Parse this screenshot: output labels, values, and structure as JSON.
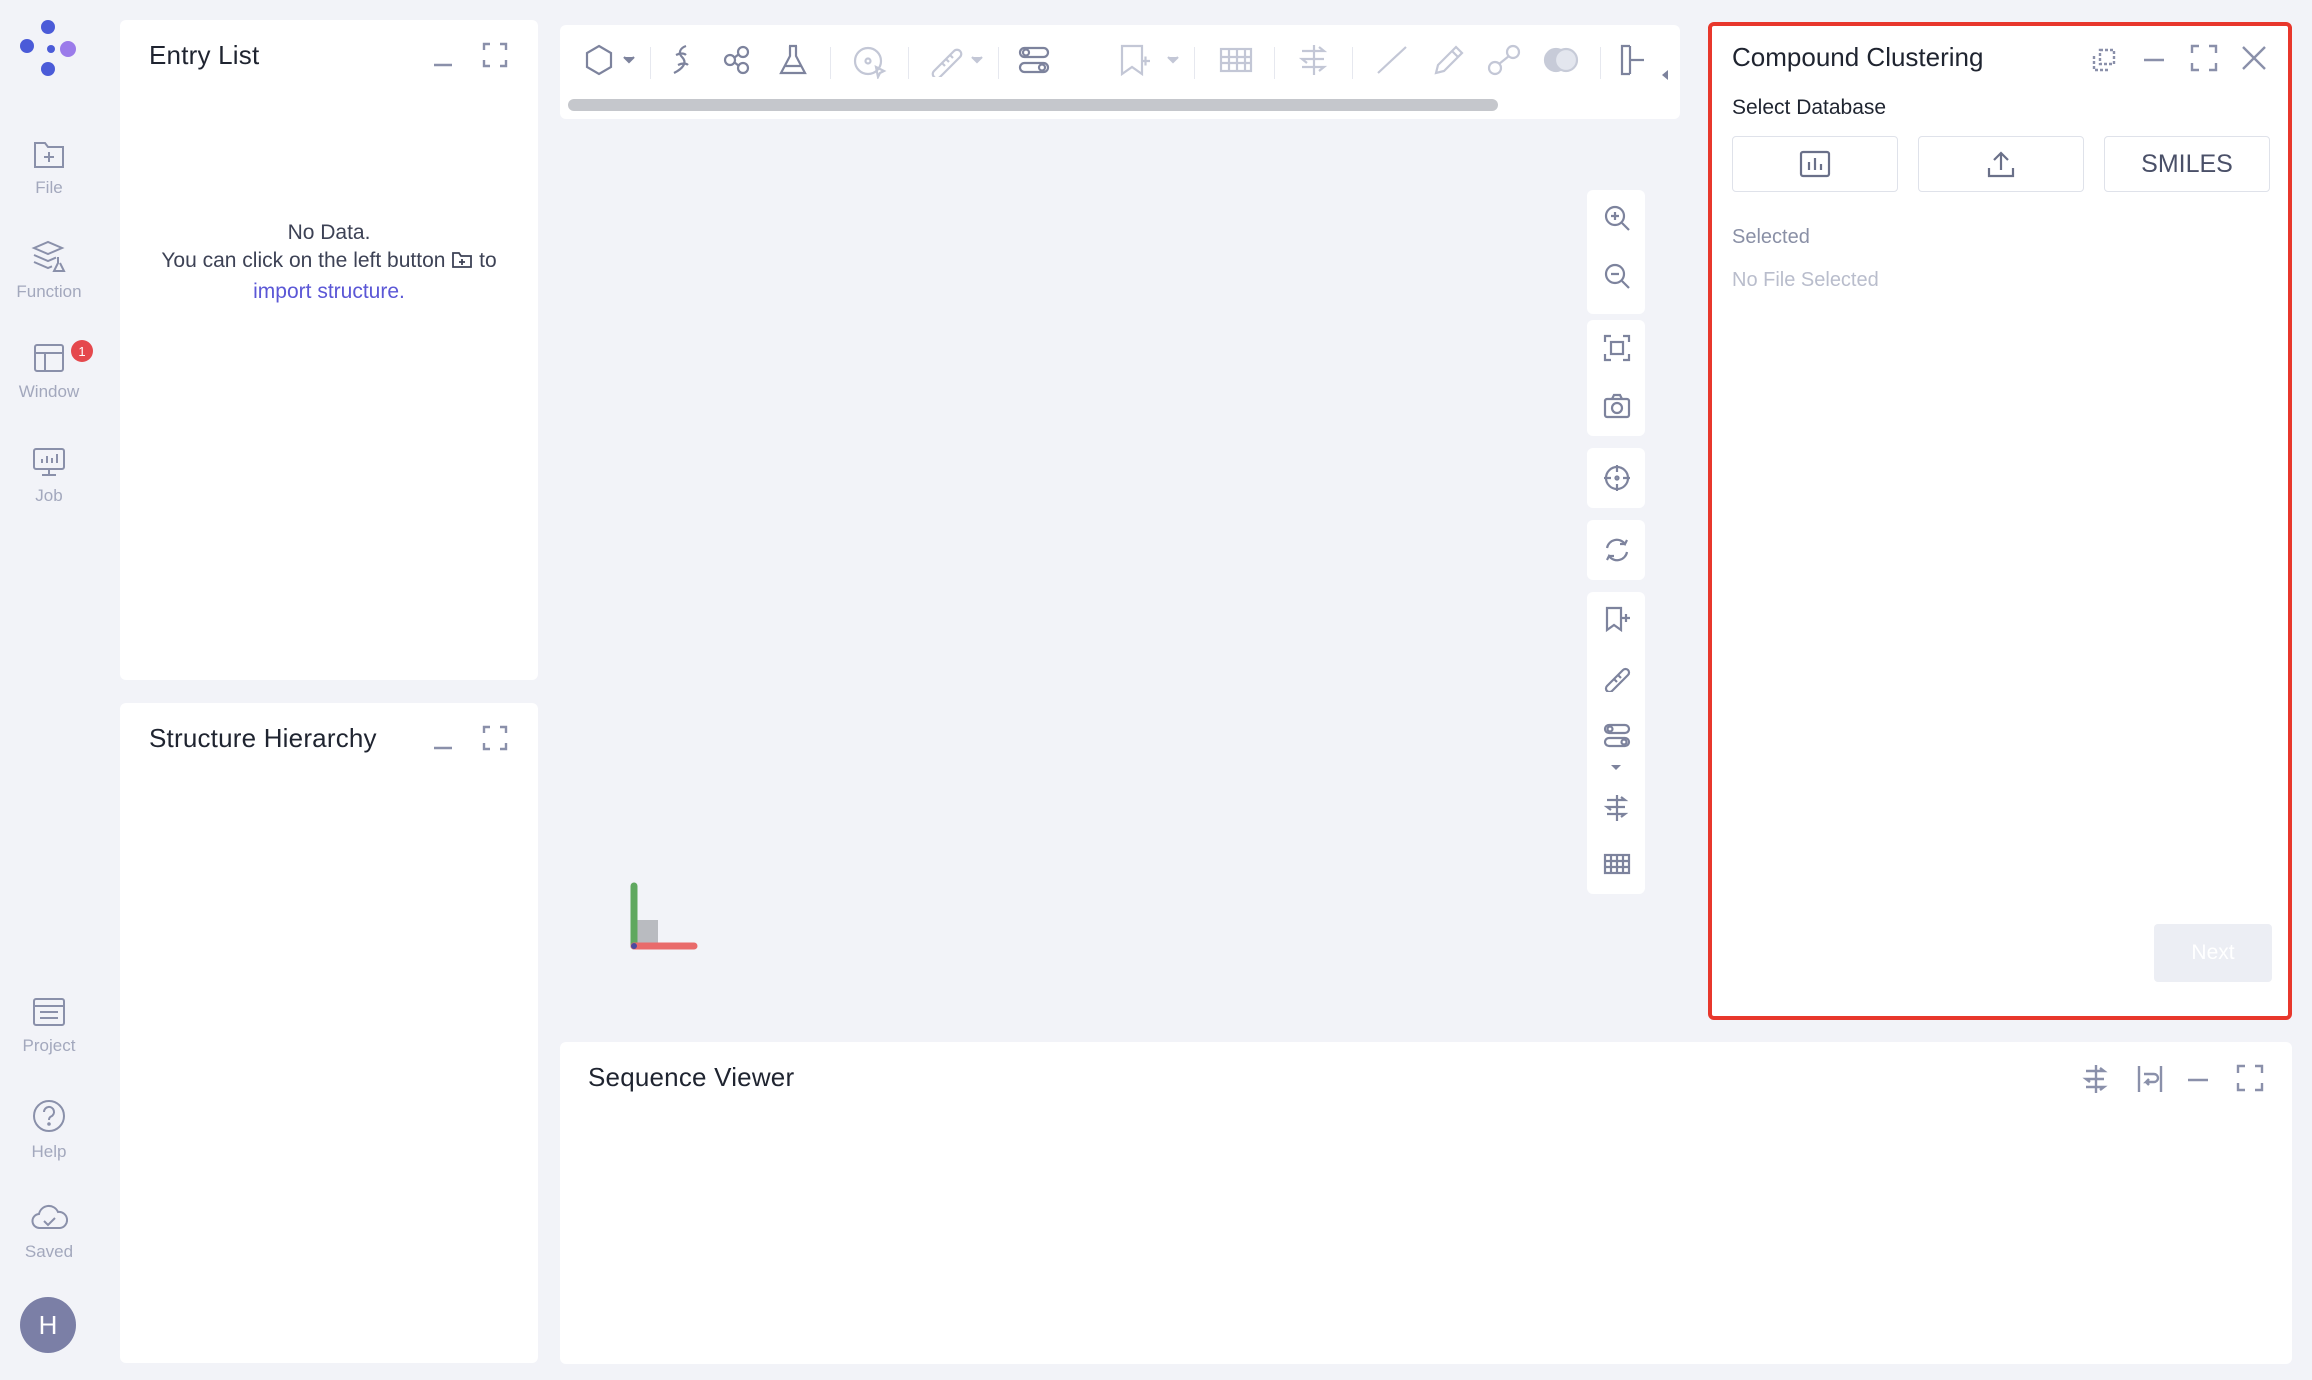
{
  "nav": {
    "items": [
      {
        "label": "File",
        "icon": "file-add-icon"
      },
      {
        "label": "Function",
        "icon": "function-icon"
      },
      {
        "label": "Window",
        "icon": "window-icon",
        "badge": "1"
      },
      {
        "label": "Job",
        "icon": "job-icon"
      },
      {
        "label": "Project",
        "icon": "project-icon"
      },
      {
        "label": "Help",
        "icon": "help-icon"
      },
      {
        "label": "Saved",
        "icon": "cloud-saved-icon"
      }
    ],
    "avatar": "H",
    "logo": "app-logo"
  },
  "entry_list": {
    "title": "Entry List",
    "empty_line1": "No Data.",
    "empty_line2_prefix": "You can click on the left button",
    "empty_line2_suffix": "to",
    "empty_link": "import structure."
  },
  "structure_hierarchy": {
    "title": "Structure Hierarchy"
  },
  "compound_clustering": {
    "title": "Compound Clustering",
    "section_label": "Select Database",
    "buttons": [
      {
        "icon": "database-chart-icon",
        "label": ""
      },
      {
        "icon": "upload-icon",
        "label": ""
      },
      {
        "icon": "",
        "label": "SMILES"
      }
    ],
    "selected_label": "Selected",
    "selected_value": "No File Selected",
    "next_label": "Next"
  },
  "sequence_viewer": {
    "title": "Sequence Viewer"
  },
  "colors": {
    "accent": "#5b57d6",
    "highlight_border": "#e8372c",
    "badge": "#e5484d",
    "background": "#f2f3f8"
  }
}
